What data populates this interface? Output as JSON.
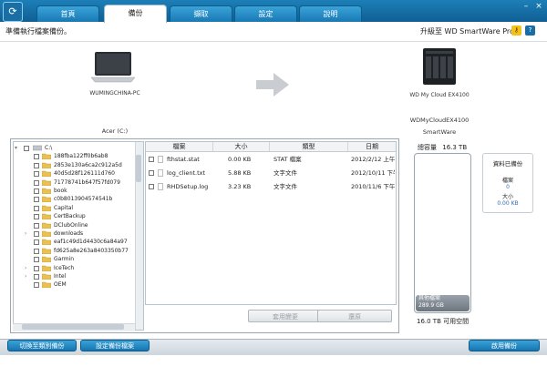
{
  "tabs": [
    "首頁",
    "備份",
    "擷取",
    "設定",
    "說明"
  ],
  "active_tab": "備份",
  "status_text": "準備執行檔案備份。",
  "upgrade_text": "升級至 WD SmartWare Pro",
  "source": {
    "computer_name": "WUMINGCHINA-PC",
    "drive_label": "Acer (C:)"
  },
  "destination": {
    "device_name": "WD My Cloud EX4100",
    "share_name": "WDMyCloudEX4100",
    "share_folder": "SmartWare"
  },
  "tree": {
    "root": "C:\\",
    "items": [
      "188fba122ff0b6ab8",
      "2853e130a6ca2c912a5d",
      "40d5d28f126111d760",
      "71778741b647f57fd079",
      "book",
      "c0b8013904574541b",
      "Capital",
      "CertBackup",
      "DClubOnline",
      "downloads",
      "eaf1c49d1d4430c6a84a97",
      "fd625a8e263a8403350b77",
      "Garmin",
      "IceTech",
      "Intel",
      "OEM"
    ]
  },
  "file_columns": [
    "檔案",
    "大小",
    "類型",
    "日期"
  ],
  "files": [
    {
      "name": "fthstat.stat",
      "size": "0.00 KB",
      "type": "STAT 檔案",
      "date": "2012/2/12 上午"
    },
    {
      "name": "log_client.txt",
      "size": "5.88 KB",
      "type": "文字文件",
      "date": "2012/10/11 下午"
    },
    {
      "name": "RHDSetup.log",
      "size": "3.23 KB",
      "type": "文字文件",
      "date": "2010/11/6 下午"
    }
  ],
  "buttons": {
    "apply_changes": "套用變更",
    "revert": "還原",
    "switch_to_category": "切換至類別備份",
    "backup_settings": "設定備份檔案",
    "start_backup": "啟用備份"
  },
  "capacity": {
    "title": "總容量",
    "total": "16.3 TB",
    "other_label": "其他檔案",
    "other_value": "289.9 GB",
    "free_text": "16.0 TB 可用空間"
  },
  "summary": {
    "title": "資料已備份",
    "files_label": "檔案",
    "files_value": "0",
    "size_label": "大小",
    "size_value": "0.00 KB"
  },
  "colors": {
    "accent_blue": "#1879b5",
    "link_blue": "#2b6fb5"
  }
}
